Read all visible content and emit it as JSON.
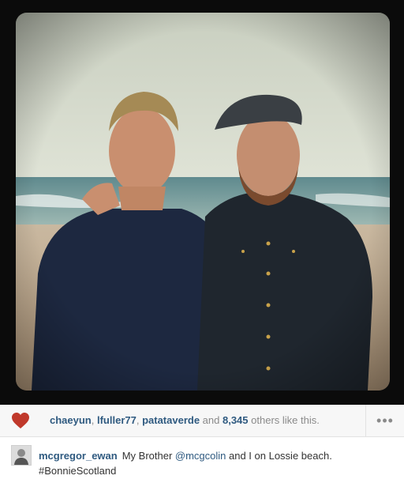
{
  "post": {
    "likes": {
      "users": [
        "chaeyun",
        "lfuller77",
        "patataverde"
      ],
      "separator": ", ",
      "joiner": " and ",
      "count": "8,345",
      "suffix": " others like this."
    },
    "caption": {
      "author": "mcgregor_ewan",
      "text_before": "My Brother ",
      "mention": "@mcgcolin",
      "text_after": " and I on Lossie beach.",
      "hashtag": "#BonnieScotland"
    },
    "more_label": "•••"
  },
  "colors": {
    "link": "#2f5a80",
    "heart": "#c0392b",
    "muted": "#8a8a8a"
  },
  "icons": {
    "like": "heart-icon",
    "more": "ellipsis-icon"
  }
}
